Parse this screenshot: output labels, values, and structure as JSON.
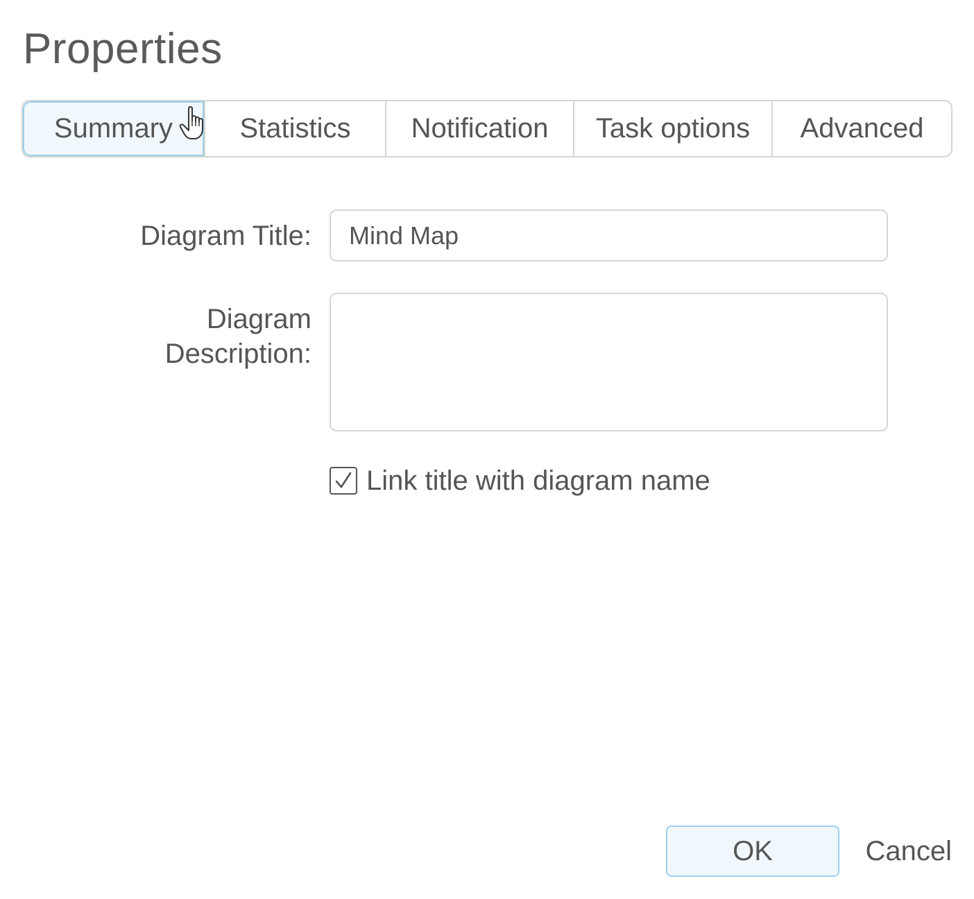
{
  "dialog": {
    "title": "Properties"
  },
  "tabs": [
    {
      "label": "Summary",
      "active": true
    },
    {
      "label": "Statistics",
      "active": false
    },
    {
      "label": "Notification",
      "active": false
    },
    {
      "label": "Task options",
      "active": false
    },
    {
      "label": "Advanced",
      "active": false
    }
  ],
  "summary": {
    "title_label": "Diagram Title:",
    "title_value": "Mind Map",
    "description_label_line1": "Diagram",
    "description_label_line2": "Description:",
    "description_value": "",
    "link_checkbox_label": "Link title with diagram name",
    "link_checkbox_checked": true,
    "checkmark_glyph": "✓"
  },
  "footer": {
    "ok_label": "OK",
    "cancel_label": "Cancel"
  },
  "colors": {
    "accent_border": "#9cd0ee",
    "accent_fill": "#f1f8fd",
    "text": "#555555",
    "border": "#d4d4d4"
  },
  "icons": {
    "cursor": "hand-pointer-icon",
    "checkbox": "checkmark-icon"
  }
}
